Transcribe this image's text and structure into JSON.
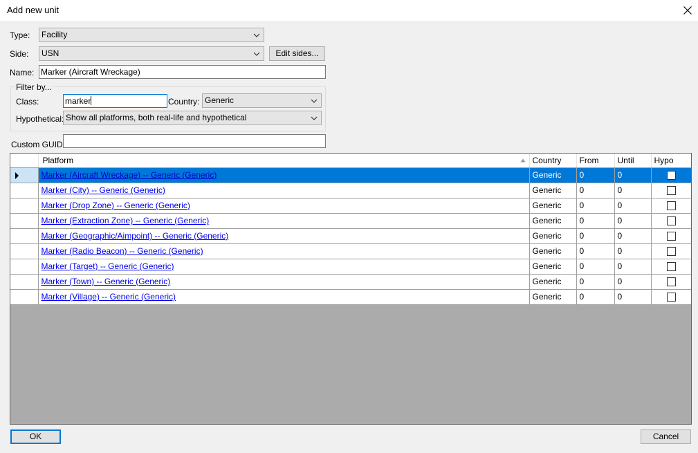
{
  "window": {
    "title": "Add new unit",
    "close_icon": "close-icon"
  },
  "form": {
    "type_label": "Type:",
    "type_value": "Facility",
    "side_label": "Side:",
    "side_value": "USN",
    "edit_sides_label": "Edit sides...",
    "name_label": "Name:",
    "name_value": "Marker (Aircraft Wreckage)",
    "filter_label": "Filter by...",
    "class_label": "Class:",
    "class_value": "marker",
    "country_label": "Country:",
    "country_value": "Generic",
    "hypothetical_label": "Hypothetical:",
    "hypothetical_value": "Show all platforms, both real-life and hypothetical",
    "guid_label": "Custom GUID:",
    "guid_value": ""
  },
  "grid": {
    "columns": [
      "Platform",
      "Country",
      "From",
      "Until",
      "Hypo"
    ],
    "sorted_column": "Platform",
    "selected_row": 0,
    "rows": [
      {
        "platform": "Marker (Aircraft Wreckage) -- Generic (Generic)",
        "country": "Generic",
        "from": "0",
        "until": "0",
        "hypo": false
      },
      {
        "platform": "Marker (City) -- Generic (Generic)",
        "country": "Generic",
        "from": "0",
        "until": "0",
        "hypo": false
      },
      {
        "platform": "Marker (Drop Zone) -- Generic (Generic)",
        "country": "Generic",
        "from": "0",
        "until": "0",
        "hypo": false
      },
      {
        "platform": "Marker (Extraction Zone) -- Generic (Generic)",
        "country": "Generic",
        "from": "0",
        "until": "0",
        "hypo": false
      },
      {
        "platform": "Marker (Geographic/Aimpoint) -- Generic (Generic)",
        "country": "Generic",
        "from": "0",
        "until": "0",
        "hypo": false
      },
      {
        "platform": "Marker (Radio Beacon) -- Generic (Generic)",
        "country": "Generic",
        "from": "0",
        "until": "0",
        "hypo": false
      },
      {
        "platform": "Marker (Target) -- Generic (Generic)",
        "country": "Generic",
        "from": "0",
        "until": "0",
        "hypo": false
      },
      {
        "platform": "Marker (Town) -- Generic (Generic)",
        "country": "Generic",
        "from": "0",
        "until": "0",
        "hypo": false
      },
      {
        "platform": "Marker (Village) -- Generic (Generic)",
        "country": "Generic",
        "from": "0",
        "until": "0",
        "hypo": false
      }
    ]
  },
  "footer": {
    "ok_label": "OK",
    "cancel_label": "Cancel"
  },
  "colors": {
    "selection": "#0078d7",
    "link": "#0000ee",
    "grid_empty": "#ababab",
    "focus": "#0078d7"
  }
}
